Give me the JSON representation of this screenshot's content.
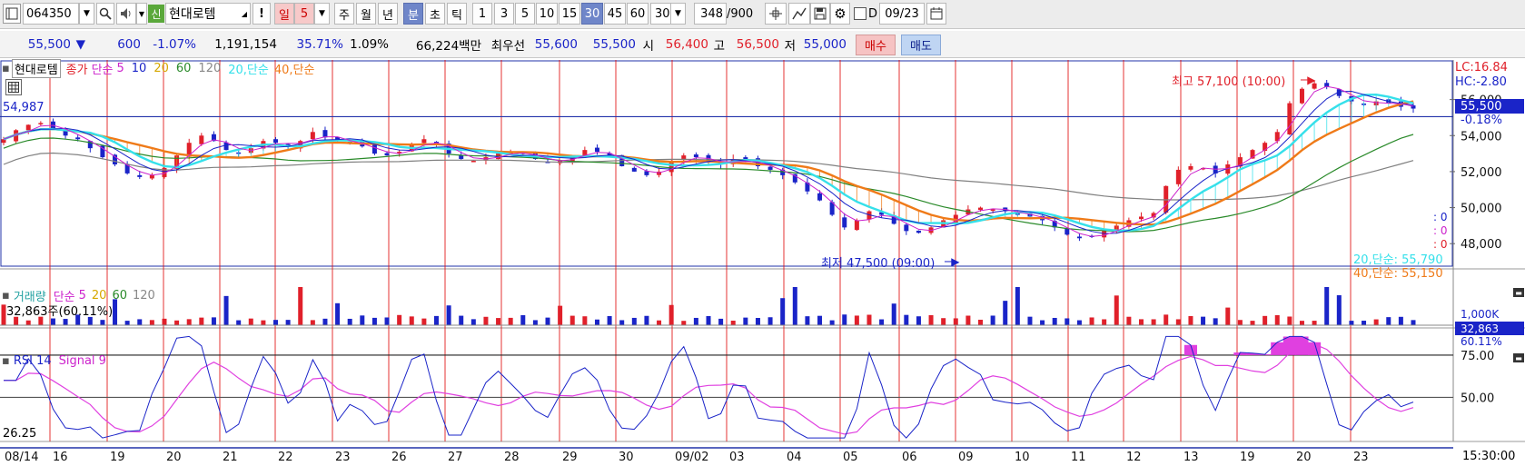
{
  "toolbar": {
    "code_value": "064350",
    "new_badge": "신",
    "stock_name": "현대로템",
    "excl_label": "!",
    "period_day": "일",
    "period_value": "5",
    "period_week": "주",
    "period_month": "월",
    "period_year": "년",
    "period_minute": "분",
    "period_second": "초",
    "period_tick": "틱",
    "intervals": [
      "1",
      "3",
      "5",
      "10",
      "15",
      "30",
      "45",
      "60"
    ],
    "interval_active": "30",
    "interval_select": "30",
    "count_value": "348",
    "count_total": "/900",
    "date_label": "D",
    "date_value": "09/23"
  },
  "info": {
    "price": "55,500",
    "direction": "▼",
    "change": "600",
    "change_pct": "-1.07%",
    "volume": "1,191,154",
    "ratio1": "35.71%",
    "ratio2": "1.09%",
    "amount": "66,224백만",
    "best_label": "최우선",
    "best_ask": "55,600",
    "best_bid": "55,500",
    "open_label": "시",
    "open": "56,400",
    "high_label": "고",
    "high": "56,500",
    "low_label": "저",
    "low": "55,000",
    "buy_label": "매수",
    "sell_label": "매도"
  },
  "price_legend": {
    "name": "현대로템",
    "close_label": "종가",
    "ma_type": "단순",
    "p5": "5",
    "p10": "10",
    "p20": "20",
    "p60": "60",
    "p120": "120",
    "env20": "20,단순",
    "env40": "40,단순"
  },
  "price_panel": {
    "left_value": "54,987",
    "high_annotation": "최고 57,100 (10:00)",
    "low_annotation": "최저 47,500 (09:00)",
    "lc": "LC:16.84",
    "hc": "HC:-2.80",
    "current_price": "55,500",
    "current_pct": "-0.18%",
    "zero1": ": 0",
    "zero2": ": 0",
    "zero3": ": 0",
    "env20_value": "20,단순: 55,790",
    "env40_value": "40,단순: 55,150"
  },
  "volume_panel": {
    "label": "거래량",
    "ma_type": "단순",
    "p5": "5",
    "p20": "20",
    "p60": "60",
    "p120": "120",
    "value": "32,863주(60.11%)",
    "axis_label": "1,000K",
    "current": "32,863",
    "current_pct": "60.11%"
  },
  "rsi_panel": {
    "label": "RSI 14",
    "signal_label": "Signal 9",
    "left_value": "26.25"
  },
  "time_axis": {
    "end_time": "15:30:00"
  },
  "colors": {
    "up": "#e0202a",
    "down": "#1a24c8",
    "ma5": "#cc22cc",
    "ma10": "#1a24c8",
    "ma60": "#2a8a2a",
    "ma120": "#808080",
    "env20": "#35e0ea",
    "env40": "#ef7a18",
    "rsi": "#1a24c8",
    "signal": "#e040e0",
    "grid_vertical": "#e01010",
    "accent_blue": "#3050c0"
  },
  "chart_data": {
    "type": "candlestick",
    "x_tick_labels": [
      "08/14",
      "16",
      "19",
      "20",
      "21",
      "22",
      "23",
      "26",
      "27",
      "28",
      "29",
      "30",
      "09/02",
      "03",
      "04",
      "05",
      "06",
      "09",
      "10",
      "11",
      "12",
      "13",
      "19",
      "20",
      "23"
    ],
    "y_tick_labels": [
      "56,000",
      "54,000",
      "52,000",
      "50,000",
      "48,000"
    ],
    "y_range": [
      46800,
      58100
    ],
    "close_series_approx": [
      53800,
      54300,
      54600,
      54700,
      54400,
      54000,
      53800,
      53300,
      52800,
      52400,
      51900,
      51700,
      51800,
      52200,
      52900,
      53600,
      54000,
      53700,
      53200,
      53000,
      53300,
      53700,
      53600,
      53400,
      53700,
      54200,
      53900,
      53700,
      53600,
      53400,
      53000,
      52900,
      53100,
      53500,
      53800,
      53500,
      53000,
      52700,
      52600,
      52800,
      53000,
      53100,
      53000,
      52700,
      52500,
      52600,
      52900,
      53200,
      53100,
      52800,
      52300,
      52000,
      51800,
      52000,
      52600,
      52900,
      52800,
      52500,
      52400,
      52700,
      52600,
      52300,
      52100,
      51800,
      51400,
      50900,
      50400,
      49600,
      48900,
      49300,
      49800,
      49600,
      49100,
      48700,
      48600,
      48900,
      49300,
      49600,
      49900,
      50000,
      49900,
      49800,
      49600,
      49500,
      49300,
      48900,
      48500,
      48300,
      48400,
      48700,
      49000,
      49300,
      49500,
      49700,
      51200,
      52100,
      52300,
      52200,
      51900,
      52400,
      52800,
      53200,
      53600,
      54200,
      55800,
      56600,
      56900,
      56700,
      56200,
      55900,
      55700,
      55900,
      55800,
      55600,
      55500
    ],
    "volume_ylim": [
      0,
      1000000
    ],
    "rsi_ylim": [
      25,
      90
    ],
    "rsi_levels": [
      75,
      50
    ]
  }
}
